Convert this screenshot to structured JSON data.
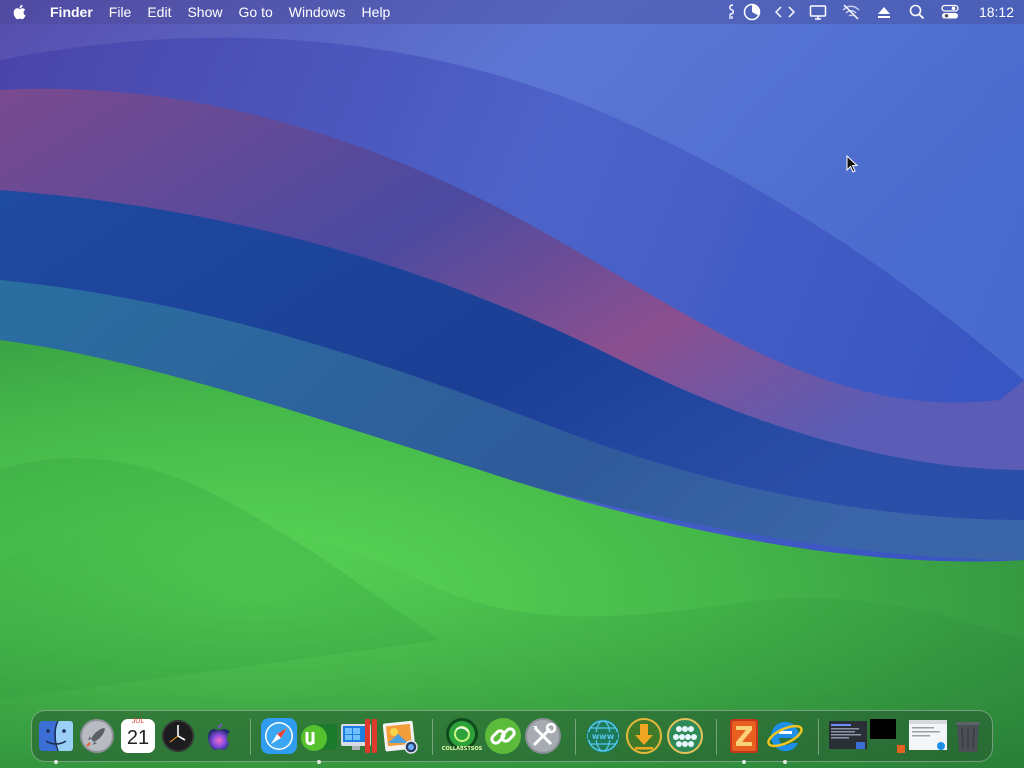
{
  "menubar": {
    "app_name": "Finder",
    "items": [
      "File",
      "Edit",
      "Show",
      "Go to",
      "Windows",
      "Help"
    ],
    "status_icons": [
      "script-icon",
      "pie-chart-icon",
      "code-brackets-icon",
      "display-icon",
      "wifi-off-icon",
      "eject-icon",
      "spotlight-search-icon",
      "control-center-icon"
    ],
    "clock": "18:12"
  },
  "dock": {
    "calendar": {
      "month": "JUL",
      "day": "21"
    },
    "collab_label": "COLLABSTSOS",
    "items": [
      {
        "name": "finder",
        "running": true
      },
      {
        "name": "launchpad",
        "running": false
      },
      {
        "name": "calendar",
        "running": false
      },
      {
        "name": "clock",
        "running": false
      },
      {
        "name": "siri",
        "running": false
      },
      {
        "name": "safari",
        "running": false
      },
      {
        "name": "utorrent",
        "running": true
      },
      {
        "name": "parallels",
        "running": false
      },
      {
        "name": "preview",
        "running": false
      },
      {
        "name": "collabstsos",
        "running": false
      },
      {
        "name": "link-tool",
        "running": false
      },
      {
        "name": "system-tools",
        "running": false
      },
      {
        "name": "www-browser",
        "running": false
      },
      {
        "name": "downloader",
        "running": false
      },
      {
        "name": "cluster-app",
        "running": false
      },
      {
        "name": "filezilla",
        "running": true
      },
      {
        "name": "internet-explorer",
        "running": true
      },
      {
        "name": "window-preview-1",
        "running": false
      },
      {
        "name": "window-preview-2",
        "running": false
      },
      {
        "name": "window-preview-3",
        "running": false
      },
      {
        "name": "trash",
        "running": false
      }
    ]
  },
  "colors": {
    "menubar_text": "#ffffff",
    "wallpaper_blue": "#3d55c0",
    "wallpaper_purple": "#8a4a86",
    "wallpaper_green": "#4ec64f"
  }
}
